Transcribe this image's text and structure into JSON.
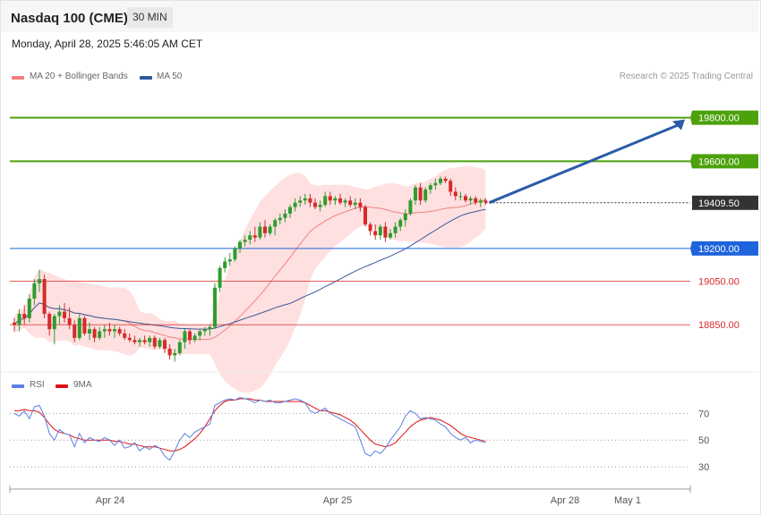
{
  "header": {
    "title": "Nasdaq 100 (CME)",
    "timeframe": "30 MIN"
  },
  "timestamp": "Monday, April 28, 2025 5:46:05 AM CET",
  "legend": {
    "ma20": "MA 20 + Bollinger Bands",
    "ma50": "MA 50"
  },
  "credit": "Research © 2025 Trading Central",
  "rsi_legend": {
    "rsi": "RSI",
    "ma": "9MA"
  },
  "colors": {
    "up": "#2e9c2e",
    "down": "#d52a2a",
    "resistance": "#4ca10c",
    "pivot": "#1e64dc",
    "support": "#d52a2a",
    "bands": "#ffd6d6",
    "ma20": "#f08080",
    "ma50": "#3a5a9a",
    "rsi": "#5b7fe0",
    "rsi_ma": "#e01010",
    "arrow": "#2b5ca8",
    "last": "#333333"
  },
  "chart_data": {
    "type": "candlestick",
    "y_range": [
      18650,
      19950
    ],
    "x_labels": [
      "Apr 24",
      "Apr 25",
      "Apr 28",
      "May 1"
    ],
    "levels": [
      {
        "label": "19800.00",
        "value": 19800,
        "kind": "resistance"
      },
      {
        "label": "19600.00",
        "value": 19600,
        "kind": "resistance"
      },
      {
        "label": "19409.50",
        "value": 19409.5,
        "kind": "last"
      },
      {
        "label": "19200.00",
        "value": 19200,
        "kind": "pivot"
      },
      {
        "label": "19050.00",
        "value": 19050,
        "kind": "support"
      },
      {
        "label": "18850.00",
        "value": 18850,
        "kind": "support"
      }
    ],
    "target": {
      "from": 19410,
      "to": 19800
    },
    "candles": [
      [
        18860,
        18880,
        18820,
        18850
      ],
      [
        18850,
        18920,
        18820,
        18900
      ],
      [
        18900,
        18940,
        18850,
        18880
      ],
      [
        18880,
        18990,
        18860,
        18970
      ],
      [
        18970,
        19060,
        18940,
        19040
      ],
      [
        19040,
        19100,
        19000,
        19060
      ],
      [
        19060,
        19080,
        18880,
        18900
      ],
      [
        18900,
        18910,
        18800,
        18830
      ],
      [
        18830,
        18900,
        18760,
        18890
      ],
      [
        18890,
        18940,
        18850,
        18910
      ],
      [
        18910,
        18950,
        18860,
        18880
      ],
      [
        18880,
        18930,
        18830,
        18850
      ],
      [
        18850,
        18870,
        18770,
        18790
      ],
      [
        18790,
        18900,
        18780,
        18880
      ],
      [
        18880,
        18890,
        18800,
        18810
      ],
      [
        18810,
        18860,
        18780,
        18830
      ],
      [
        18830,
        18840,
        18770,
        18790
      ],
      [
        18790,
        18840,
        18780,
        18820
      ],
      [
        18820,
        18850,
        18790,
        18830
      ],
      [
        18830,
        18860,
        18800,
        18820
      ],
      [
        18820,
        18850,
        18790,
        18830
      ],
      [
        18830,
        18840,
        18800,
        18810
      ],
      [
        18810,
        18830,
        18780,
        18790
      ],
      [
        18790,
        18810,
        18770,
        18780
      ],
      [
        18780,
        18800,
        18760,
        18770
      ],
      [
        18770,
        18790,
        18750,
        18780
      ],
      [
        18780,
        18800,
        18760,
        18770
      ],
      [
        18770,
        18800,
        18750,
        18790
      ],
      [
        18790,
        18800,
        18740,
        18750
      ],
      [
        18750,
        18790,
        18740,
        18780
      ],
      [
        18780,
        18790,
        18720,
        18740
      ],
      [
        18740,
        18760,
        18690,
        18710
      ],
      [
        18710,
        18740,
        18680,
        18720
      ],
      [
        18720,
        18780,
        18710,
        18770
      ],
      [
        18770,
        18830,
        18740,
        18820
      ],
      [
        18820,
        18830,
        18760,
        18780
      ],
      [
        18780,
        18810,
        18770,
        18800
      ],
      [
        18800,
        18830,
        18780,
        18820
      ],
      [
        18820,
        18840,
        18800,
        18830
      ],
      [
        18830,
        18850,
        18800,
        18840
      ],
      [
        18840,
        19040,
        18830,
        19020
      ],
      [
        19020,
        19120,
        19000,
        19110
      ],
      [
        19110,
        19160,
        19090,
        19140
      ],
      [
        19140,
        19180,
        19120,
        19150
      ],
      [
        19150,
        19210,
        19140,
        19200
      ],
      [
        19200,
        19240,
        19180,
        19230
      ],
      [
        19230,
        19260,
        19210,
        19240
      ],
      [
        19240,
        19280,
        19220,
        19260
      ],
      [
        19260,
        19300,
        19230,
        19250
      ],
      [
        19250,
        19320,
        19240,
        19300
      ],
      [
        19300,
        19330,
        19250,
        19270
      ],
      [
        19270,
        19310,
        19260,
        19300
      ],
      [
        19300,
        19340,
        19260,
        19330
      ],
      [
        19330,
        19360,
        19310,
        19340
      ],
      [
        19340,
        19380,
        19320,
        19360
      ],
      [
        19360,
        19400,
        19340,
        19390
      ],
      [
        19390,
        19430,
        19370,
        19410
      ],
      [
        19410,
        19440,
        19390,
        19420
      ],
      [
        19420,
        19450,
        19400,
        19430
      ],
      [
        19430,
        19450,
        19390,
        19410
      ],
      [
        19410,
        19430,
        19380,
        19390
      ],
      [
        19390,
        19420,
        19370,
        19400
      ],
      [
        19400,
        19460,
        19390,
        19440
      ],
      [
        19440,
        19460,
        19400,
        19420
      ],
      [
        19420,
        19440,
        19400,
        19430
      ],
      [
        19430,
        19450,
        19400,
        19410
      ],
      [
        19410,
        19430,
        19390,
        19420
      ],
      [
        19420,
        19440,
        19390,
        19400
      ],
      [
        19400,
        19430,
        19380,
        19410
      ],
      [
        19410,
        19430,
        19370,
        19390
      ],
      [
        19390,
        19400,
        19300,
        19310
      ],
      [
        19310,
        19320,
        19260,
        19280
      ],
      [
        19280,
        19310,
        19240,
        19260
      ],
      [
        19260,
        19310,
        19240,
        19300
      ],
      [
        19300,
        19320,
        19230,
        19250
      ],
      [
        19250,
        19290,
        19240,
        19270
      ],
      [
        19270,
        19320,
        19250,
        19300
      ],
      [
        19300,
        19340,
        19280,
        19330
      ],
      [
        19330,
        19380,
        19300,
        19360
      ],
      [
        19360,
        19430,
        19350,
        19420
      ],
      [
        19420,
        19490,
        19400,
        19480
      ],
      [
        19480,
        19500,
        19400,
        19420
      ],
      [
        19420,
        19480,
        19410,
        19470
      ],
      [
        19470,
        19500,
        19450,
        19490
      ],
      [
        19490,
        19520,
        19470,
        19500
      ],
      [
        19500,
        19530,
        19490,
        19520
      ],
      [
        19520,
        19530,
        19500,
        19510
      ],
      [
        19510,
        19520,
        19440,
        19460
      ],
      [
        19460,
        19480,
        19420,
        19440
      ],
      [
        19440,
        19460,
        19420,
        19440
      ],
      [
        19440,
        19450,
        19410,
        19420
      ],
      [
        19420,
        19440,
        19400,
        19430
      ],
      [
        19430,
        19440,
        19400,
        19410
      ],
      [
        19410,
        19430,
        19390,
        19420
      ],
      [
        19420,
        19430,
        19400,
        19410
      ]
    ],
    "rsi": {
      "levels": [
        70,
        50,
        30
      ],
      "y_range": [
        18,
        85
      ],
      "rsi_values": [
        70,
        68,
        72,
        66,
        75,
        76,
        68,
        55,
        50,
        58,
        55,
        54,
        45,
        55,
        48,
        52,
        50,
        49,
        52,
        50,
        46,
        50,
        44,
        45,
        48,
        42,
        45,
        43,
        46,
        44,
        38,
        35,
        42,
        50,
        55,
        52,
        56,
        58,
        60,
        62,
        76,
        78,
        80,
        81,
        80,
        82,
        81,
        80,
        78,
        80,
        79,
        80,
        78,
        78,
        79,
        80,
        81,
        80,
        78,
        72,
        70,
        72,
        74,
        70,
        68,
        66,
        64,
        62,
        60,
        50,
        40,
        38,
        42,
        40,
        44,
        50,
        55,
        60,
        68,
        72,
        70,
        66,
        67,
        66,
        65,
        62,
        60,
        55,
        52,
        50,
        52,
        48,
        50,
        49,
        48
      ],
      "ma_values": [
        72,
        72,
        73,
        72,
        72,
        71,
        67,
        62,
        58,
        56,
        55,
        54,
        52,
        51,
        50,
        50,
        50,
        50,
        50,
        50,
        49,
        49,
        48,
        47,
        47,
        46,
        45,
        45,
        45,
        44,
        43,
        42,
        42,
        43,
        45,
        48,
        51,
        55,
        60,
        66,
        72,
        76,
        79,
        80,
        80,
        81,
        81,
        81,
        80,
        80,
        79,
        79,
        79,
        79,
        79,
        79,
        79,
        79,
        78,
        76,
        74,
        72,
        72,
        71,
        70,
        69,
        67,
        65,
        62,
        58,
        54,
        50,
        47,
        46,
        45,
        46,
        48,
        52,
        56,
        60,
        63,
        65,
        66,
        67,
        66,
        65,
        63,
        61,
        58,
        55,
        53,
        52,
        51,
        50,
        49
      ]
    }
  }
}
